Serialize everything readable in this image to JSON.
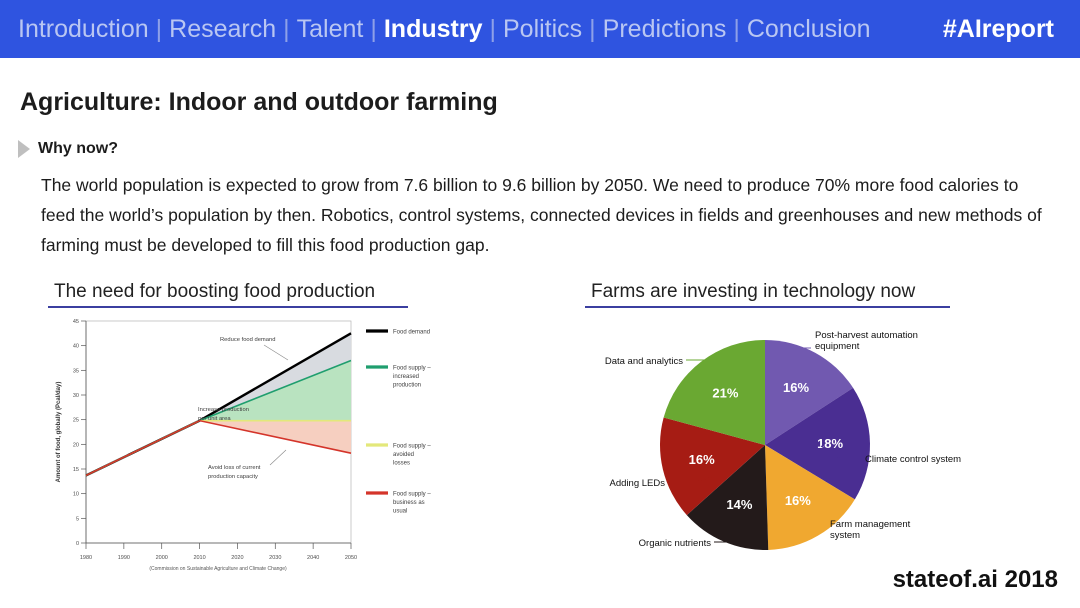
{
  "nav": {
    "items": [
      {
        "label": "Introduction",
        "active": false
      },
      {
        "label": "Research",
        "active": false
      },
      {
        "label": "Talent",
        "active": false
      },
      {
        "label": "Industry",
        "active": true
      },
      {
        "label": "Politics",
        "active": false
      },
      {
        "label": "Predictions",
        "active": false
      },
      {
        "label": "Conclusion",
        "active": false
      }
    ],
    "separator": "|",
    "hashtag": "#AIreport",
    "bar_color": "#2f54e0",
    "active_color": "#ffffff",
    "inactive_color": "#b9c6f2"
  },
  "slide": {
    "title": "Agriculture: Indoor and outdoor farming",
    "why_label": "Why now?",
    "body": "The world population is expected to grow from 7.6 billion to 9.6 billion by 2050. We need to produce 70% more food calories to feed the world’s population by then. Robotics, control systems, connected devices in fields and greenhouses and new methods of farming must be developed to fill this food production gap.",
    "brand": "stateof.ai 2018",
    "accent_rule_color": "#3b3fa0"
  },
  "left_panel": {
    "header": "The need for boosting food production"
  },
  "right_panel": {
    "header": "Farms are investing in technology now"
  },
  "chart_data": [
    {
      "type": "line",
      "title": "The need for boosting food production",
      "xlabel": "",
      "ylabel": "Amount of food, globally (Pcal/day)",
      "source": "(Commission on Sustainable Agriculture and Climate Change)",
      "xlim": [
        1980,
        2050
      ],
      "ylim": [
        0,
        45
      ],
      "xticks": [
        1980,
        1990,
        2000,
        2010,
        2020,
        2030,
        2040,
        2050
      ],
      "yticks": [
        0,
        5,
        10,
        15,
        20,
        25,
        30,
        35,
        40,
        45
      ],
      "grid": false,
      "legend_position": "right",
      "series": [
        {
          "name": "Food demand",
          "color": "#000000",
          "x": [
            1980,
            2010,
            2050
          ],
          "values": [
            13.7,
            24.8,
            42.5
          ]
        },
        {
          "name": "Food supply – increased production",
          "color": "#1f9e6e",
          "x": [
            1980,
            2010,
            2050
          ],
          "values": [
            13.7,
            24.8,
            37.0
          ]
        },
        {
          "name": "Food supply – avoided losses",
          "color": "#e3e87a",
          "x": [
            1980,
            2010,
            2050
          ],
          "values": [
            13.7,
            24.8,
            24.8
          ]
        },
        {
          "name": "Food supply – business as usual",
          "color": "#d4342a",
          "x": [
            1980,
            2010,
            2050
          ],
          "values": [
            13.7,
            24.8,
            18.2
          ]
        }
      ],
      "annotations": [
        "Reduce food demand",
        "Increase production per unit area",
        "Avoid loss of current production capacity"
      ]
    },
    {
      "type": "pie",
      "title": "Farms are investing in technology now",
      "legend_position": "callout-labels",
      "categories": [
        "Post-harvest automation equipment",
        "Climate control system",
        "Farm management system",
        "Organic nutrients",
        "Adding LEDs",
        "Data and analytics"
      ],
      "values": [
        16,
        18,
        16,
        14,
        16,
        21
      ],
      "value_labels": [
        "16%",
        "18%",
        "16%",
        "14%",
        "16%",
        "21%"
      ],
      "colors": [
        "#7159b0",
        "#4a2e92",
        "#f0a830",
        "#231a1a",
        "#a61c14",
        "#6aa832"
      ]
    }
  ]
}
